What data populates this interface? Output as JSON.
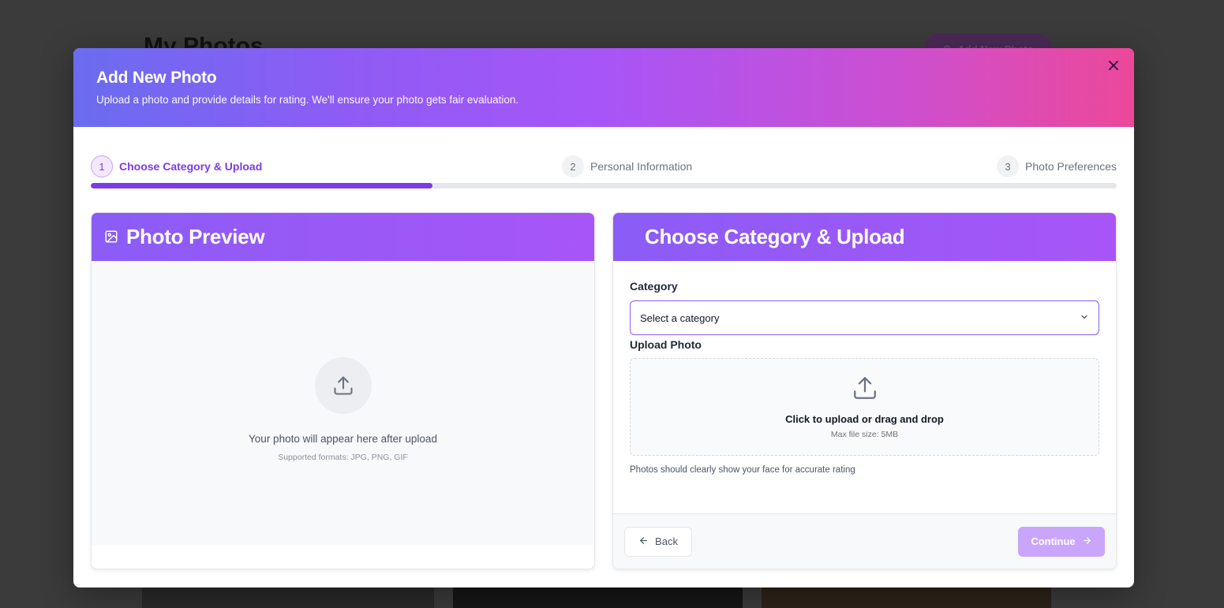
{
  "background": {
    "title": "My Photos",
    "add_button_label": "Add New Photo"
  },
  "modal": {
    "title": "Add New Photo",
    "subtitle": "Upload a photo and provide details for rating. We'll ensure your photo gets fair evaluation.",
    "close_icon": "close-icon"
  },
  "stepper": {
    "steps": [
      {
        "number": "1",
        "label": "Choose Category & Upload",
        "active": true
      },
      {
        "number": "2",
        "label": "Personal Information",
        "active": false
      },
      {
        "number": "3",
        "label": "Photo Preferences",
        "active": false
      }
    ],
    "progress_fraction": 0.333
  },
  "preview": {
    "title": "Photo Preview",
    "empty_text": "Your photo will appear here after upload",
    "formats_text": "Supported formats: JPG, PNG, GIF"
  },
  "form": {
    "title": "Choose Category & Upload",
    "category_label": "Category",
    "category_value": "Select a category",
    "upload_label": "Upload Photo",
    "upload_main": "Click to upload or drag and drop",
    "upload_sub": "Max file size: 5MB",
    "hint": "Photos should clearly show your face for accurate rating",
    "back_label": "Back",
    "continue_label": "Continue"
  },
  "colors": {
    "accent": "#7c3aed",
    "header_gradient_start": "#6a6cf0",
    "header_gradient_end": "#ec4899",
    "continue_disabled": "#c9a6fb"
  }
}
